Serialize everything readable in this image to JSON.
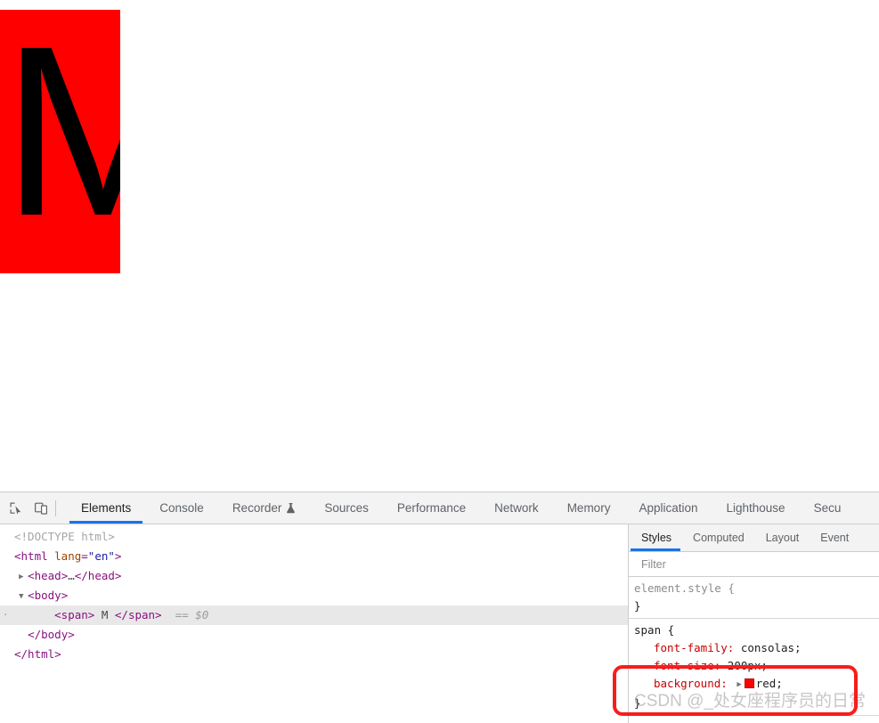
{
  "viewport": {
    "rendered_span_text": "M",
    "span_background": "#ff0000",
    "span_color": "#000000"
  },
  "devtools": {
    "toolbar_icons": [
      {
        "name": "inspect-element-icon",
        "title": "Inspect element"
      },
      {
        "name": "device-toolbar-icon",
        "title": "Toggle device toolbar"
      }
    ],
    "tabs": [
      {
        "label": "Elements",
        "active": true,
        "experimental": false
      },
      {
        "label": "Console",
        "active": false,
        "experimental": false
      },
      {
        "label": "Recorder",
        "active": false,
        "experimental": true
      },
      {
        "label": "Sources",
        "active": false,
        "experimental": false
      },
      {
        "label": "Performance",
        "active": false,
        "experimental": false
      },
      {
        "label": "Network",
        "active": false,
        "experimental": false
      },
      {
        "label": "Memory",
        "active": false,
        "experimental": false
      },
      {
        "label": "Application",
        "active": false,
        "experimental": false
      },
      {
        "label": "Lighthouse",
        "active": false,
        "experimental": false
      },
      {
        "label": "Secu",
        "active": false,
        "experimental": false
      }
    ],
    "dom_tree": {
      "rows": [
        {
          "id": "doctype",
          "twisty": "",
          "indent": 0,
          "selected": false,
          "tokens": [
            {
              "cls": "tk-doctype",
              "text": "<!DOCTYPE html>"
            }
          ]
        },
        {
          "id": "html-open",
          "twisty": "",
          "indent": 0,
          "selected": false,
          "tokens": [
            {
              "cls": "tk-tag",
              "text": "<html "
            },
            {
              "cls": "tk-attr",
              "text": "lang"
            },
            {
              "cls": "tk-tag",
              "text": "="
            },
            {
              "cls": "tk-val",
              "text": "\"en\""
            },
            {
              "cls": "tk-tag",
              "text": ">"
            }
          ]
        },
        {
          "id": "head",
          "twisty": "▶",
          "indent": 1,
          "selected": false,
          "tokens": [
            {
              "cls": "tk-tag",
              "text": "<head>"
            },
            {
              "cls": "tk-text",
              "text": "…"
            },
            {
              "cls": "tk-tag",
              "text": "</head>"
            }
          ]
        },
        {
          "id": "body-open",
          "twisty": "▼",
          "indent": 1,
          "selected": false,
          "tokens": [
            {
              "cls": "tk-tag",
              "text": "<body>"
            }
          ]
        },
        {
          "id": "span-row",
          "twisty": "",
          "indent": 3,
          "selected": true,
          "bullet": "·",
          "tokens": [
            {
              "cls": "tk-tag",
              "text": "<span>"
            },
            {
              "cls": "tk-text",
              "text": " M "
            },
            {
              "cls": "tk-tag",
              "text": "</span>"
            },
            {
              "cls": "tk-eq",
              "text": "  == "
            },
            {
              "cls": "tk-dollar",
              "text": "$0"
            }
          ]
        },
        {
          "id": "body-close",
          "twisty": "",
          "indent": 1,
          "selected": false,
          "tokens": [
            {
              "cls": "tk-tag",
              "text": "</body>"
            }
          ]
        },
        {
          "id": "html-close",
          "twisty": "",
          "indent": 0,
          "selected": false,
          "tokens": [
            {
              "cls": "tk-tag",
              "text": "</html>"
            }
          ]
        }
      ]
    },
    "styles_panel": {
      "tabs": [
        {
          "label": "Styles",
          "active": true
        },
        {
          "label": "Computed",
          "active": false
        },
        {
          "label": "Layout",
          "active": false
        },
        {
          "label": "Event",
          "active": false
        }
      ],
      "filter": {
        "value": "",
        "placeholder": "Filter"
      },
      "rules": [
        {
          "selector": "element.style {",
          "selector_style": "muted",
          "declarations": [],
          "close": "}"
        },
        {
          "selector": "span {",
          "selector_style": "normal",
          "declarations": [
            {
              "name": "font-family",
              "value": "consolas;",
              "has_swatch": false,
              "has_arrow": false
            },
            {
              "name": "font-size",
              "value": "200px;",
              "has_swatch": false,
              "has_arrow": false
            },
            {
              "name": "background",
              "value": "red;",
              "has_swatch": true,
              "swatch_color": "#ff0000",
              "has_arrow": true
            }
          ],
          "close": "}"
        }
      ]
    }
  },
  "annotation": {
    "rect_color": "#f71d1d",
    "watermark": "CSDN @_处女座程序员的日常"
  }
}
